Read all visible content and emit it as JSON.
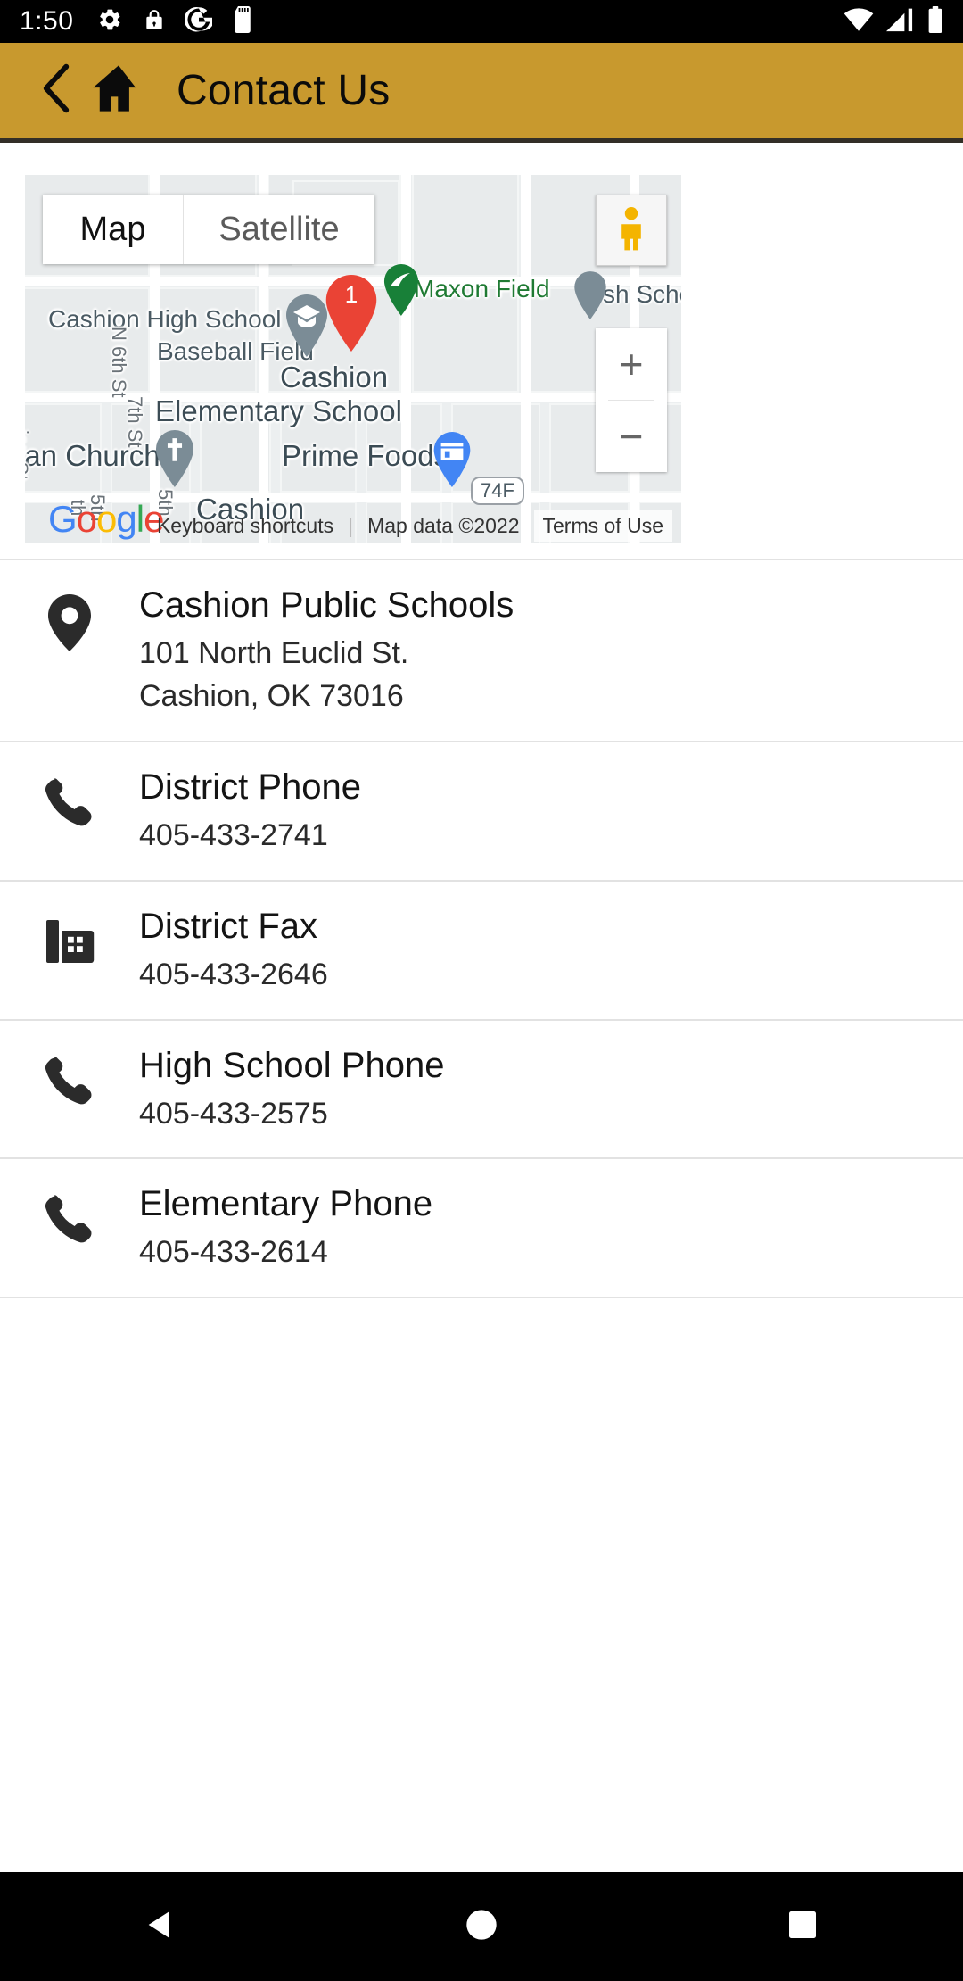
{
  "status_bar": {
    "time": "1:50",
    "left_icons": [
      "gear-icon",
      "lock-icon",
      "google-g-icon",
      "sd-card-icon"
    ],
    "right_icons": [
      "wifi-icon",
      "cellular-signal-icon",
      "battery-icon"
    ]
  },
  "app_bar": {
    "title": "Contact Us",
    "back_icon": "back-chevron-icon",
    "home_icon": "home-icon",
    "background_color": "#c8992e"
  },
  "map": {
    "tabs": [
      {
        "label": "Map",
        "active": true
      },
      {
        "label": "Satellite",
        "active": false
      }
    ],
    "controls": {
      "pegman": "street-view-pegman-icon",
      "zoom_in": "+",
      "zoom_out": "−"
    },
    "markers": [
      {
        "label": "1",
        "type": "numbered-result-marker",
        "color": "#ea4335"
      },
      {
        "label": "",
        "type": "school-marker",
        "color": "#7b8c96"
      },
      {
        "label": "",
        "type": "park-marker",
        "color": "#188038"
      },
      {
        "label": "",
        "type": "church-marker",
        "color": "#7b8c96"
      },
      {
        "label": "",
        "type": "store-marker",
        "color": "#4285f4"
      }
    ],
    "labels": [
      "Cashion High School",
      "Baseball Field",
      "Cashion",
      "Elementary School",
      "Maxon Field",
      "sh Scho",
      "ian Church",
      "Prime Foods",
      "Cashion",
      "7th St",
      "N 6th St",
      "ian St",
      "5th",
      "5th",
      "th",
      "74F"
    ],
    "logo": "Google",
    "attribution": {
      "keyboard_shortcuts": "Keyboard shortcuts",
      "map_data": "Map data ©2022",
      "terms": "Terms of Use"
    }
  },
  "contacts": [
    {
      "icon": "location-pin-icon",
      "title": "Cashion Public Schools",
      "lines": [
        "101 North Euclid St.",
        "Cashion, OK  73016"
      ]
    },
    {
      "icon": "phone-icon",
      "title": "District Phone",
      "lines": [
        "405-433-2741"
      ]
    },
    {
      "icon": "fax-icon",
      "title": "District Fax",
      "lines": [
        "405-433-2646"
      ]
    },
    {
      "icon": "phone-icon",
      "title": "High School Phone",
      "lines": [
        "405-433-2575"
      ]
    },
    {
      "icon": "phone-icon",
      "title": "Elementary Phone",
      "lines": [
        "405-433-2614"
      ]
    }
  ],
  "nav_bar": {
    "back": "nav-back-triangle-icon",
    "home": "nav-home-circle-icon",
    "recents": "nav-recents-square-icon"
  }
}
